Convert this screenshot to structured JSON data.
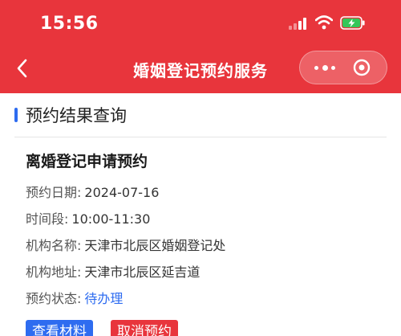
{
  "status_bar": {
    "time": "15:56"
  },
  "nav": {
    "title": "婚姻登记预约服务"
  },
  "section": {
    "title": "预约结果查询"
  },
  "record": {
    "title": "离婚登记申请预约",
    "fields": [
      {
        "label": "预约日期:",
        "value": "2024-07-16"
      },
      {
        "label": "时间段:",
        "value": "10:00-11:30"
      },
      {
        "label": "机构名称:",
        "value": "天津市北辰区婚姻登记处"
      },
      {
        "label": "机构地址:",
        "value": "天津市北辰区延吉道"
      },
      {
        "label": "预约状态:",
        "value": "待办理"
      }
    ]
  },
  "actions": {
    "view_materials": "查看材料",
    "cancel_booking": "取消预约"
  },
  "colors": {
    "header": "#e8353c",
    "accent_blue": "#2e6cf0",
    "battery_green": "#34c759"
  }
}
